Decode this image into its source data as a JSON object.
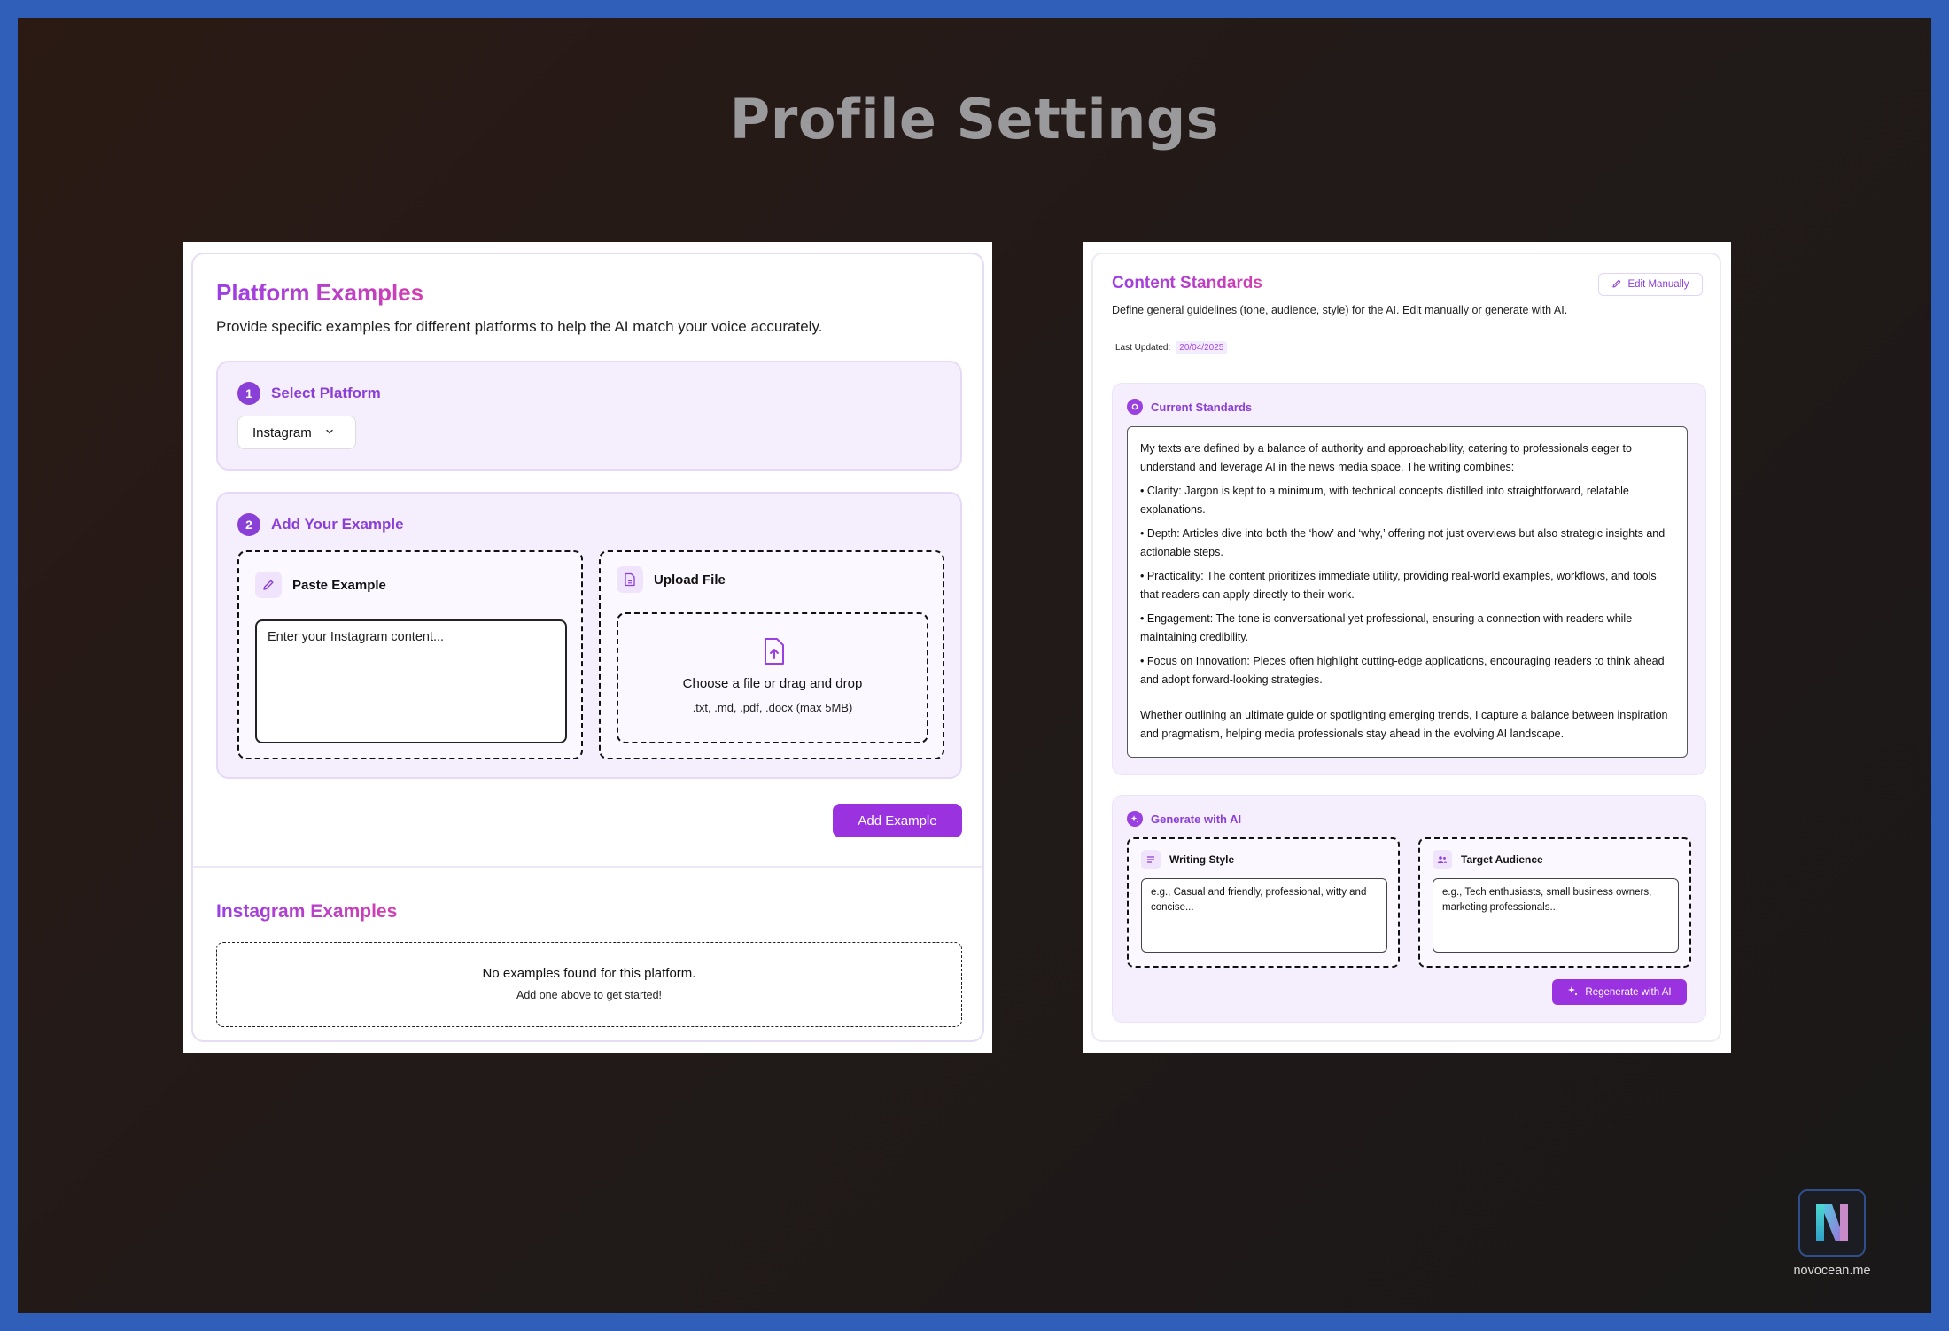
{
  "page": {
    "title": "Profile Settings"
  },
  "platform_examples": {
    "title": "Platform Examples",
    "subtitle": "Provide specific examples for different platforms to help the AI match your voice accurately.",
    "step1": {
      "number": "1",
      "label": "Select Platform",
      "selected_platform": "Instagram"
    },
    "step2": {
      "number": "2",
      "label": "Add Your Example",
      "paste": {
        "label": "Paste Example",
        "placeholder": "Enter your Instagram content..."
      },
      "upload": {
        "label": "Upload File",
        "drop_title": "Choose a file or drag and drop",
        "drop_sub": ".txt, .md, .pdf, .docx (max 5MB)"
      }
    },
    "add_button": "Add Example",
    "examples_title": "Instagram Examples",
    "empty_line1": "No examples found for this platform.",
    "empty_line2": "Add one above to get started!"
  },
  "content_standards": {
    "title": "Content Standards",
    "description": "Define general guidelines (tone, audience, style) for the AI. Edit manually or generate with AI.",
    "last_updated_label": "Last Updated:",
    "last_updated_value": "20/04/2025",
    "edit_button": "Edit Manually",
    "current_label": "Current Standards",
    "standards_paragraphs": [
      "My texts are defined by a balance of authority and approachability, catering to professionals eager to understand and leverage AI in the news media space. The writing combines:",
      "• Clarity: Jargon is kept to a minimum, with technical concepts distilled into straightforward, relatable explanations.",
      "• Depth: Articles dive into both the ‘how’ and ‘why,’ offering not just overviews but also strategic insights and actionable steps.",
      "• Practicality: The content prioritizes immediate utility, providing real-world examples, workflows, and tools that readers can apply directly to their work.",
      "• Engagement: The tone is conversational yet professional, ensuring a connection with readers while maintaining credibility.",
      "• Focus on Innovation: Pieces often highlight cutting-edge applications, encouraging readers to think ahead and adopt forward-looking strategies.",
      "Whether outlining an ultimate guide or spotlighting emerging trends, I capture a balance between inspiration and pragmatism, helping media professionals stay ahead in the evolving AI landscape."
    ],
    "generate_label": "Generate with AI",
    "writing_style": {
      "label": "Writing Style",
      "placeholder": "e.g., Casual and friendly, professional, witty and concise..."
    },
    "target_audience": {
      "label": "Target Audience",
      "placeholder": "e.g., Tech enthusiasts, small business owners, marketing professionals..."
    },
    "regenerate_button": "Regenerate with AI"
  },
  "brand": {
    "site": "novocean.me"
  },
  "colors": {
    "accent": "#9a32e0",
    "accent_light": "#f5effd",
    "background": "#221a18",
    "frame": "#2f5fb8"
  }
}
